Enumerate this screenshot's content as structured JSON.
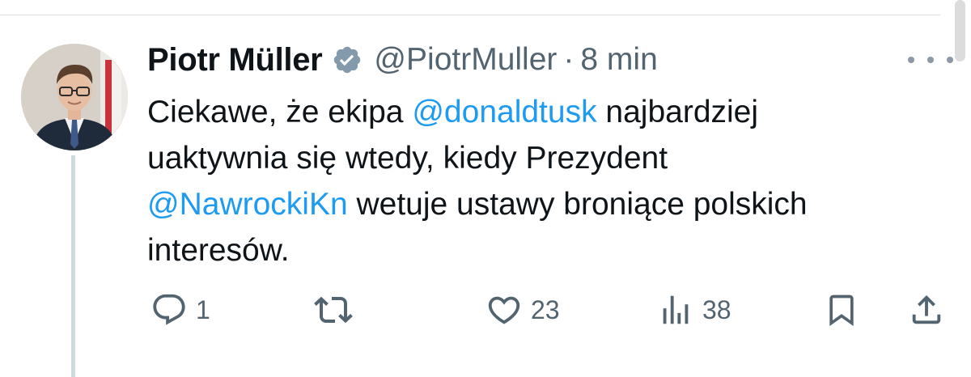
{
  "tweet": {
    "display_name": "Piotr Müller",
    "handle": "@PiotrMuller",
    "separator": "·",
    "time": "8 min",
    "body": {
      "line1_pre": "Ciekawe, że ekipa ",
      "line1_mention": "@donaldtusk",
      "line1_post": " najbardziej",
      "line2": "uaktywnia się wtedy, kiedy Prezydent",
      "line3_mention": "@NawrockiKn",
      "line3_post": " wetuje ustawy broniące polskich",
      "line4": "interesów."
    },
    "icons": {
      "verified": "verified-badge-icon",
      "more": "more-options-icon",
      "reply": "reply-icon",
      "retweet": "retweet-icon",
      "like": "like-icon",
      "views": "views-icon",
      "bookmark": "bookmark-icon",
      "share": "share-icon"
    },
    "actions": {
      "replies": "1",
      "retweets": "",
      "likes": "23",
      "views": "38"
    }
  },
  "colors": {
    "text": "#0f1419",
    "secondary": "#536471",
    "link": "#1d9bf0",
    "verified_badge": "#829aab",
    "thread_line": "#cfd9de"
  }
}
